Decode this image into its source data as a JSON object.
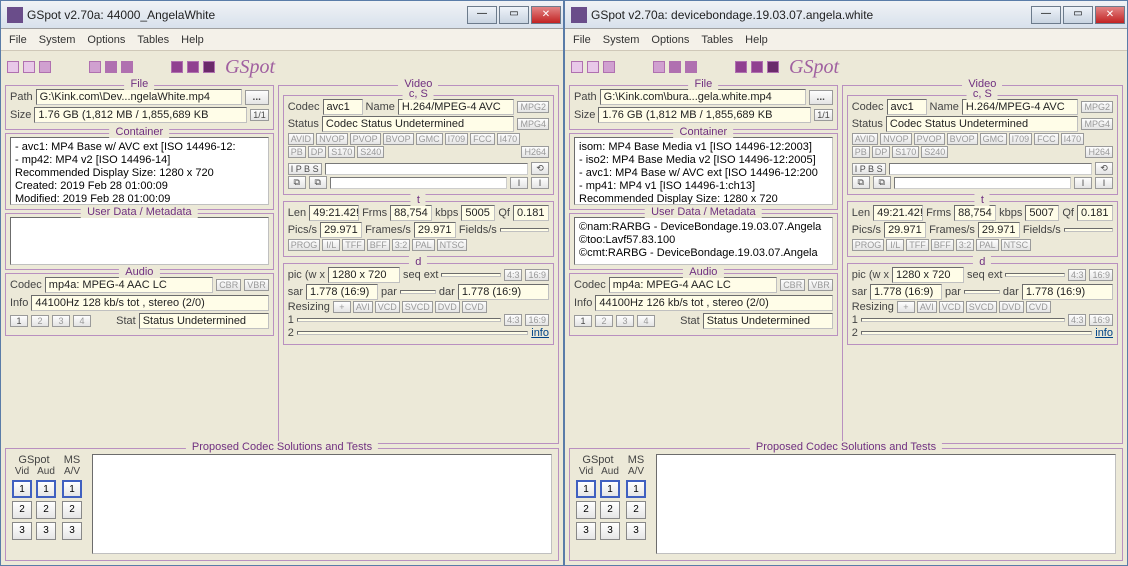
{
  "windows": [
    {
      "title": "GSpot v2.70a: 44000_AngelaWhite",
      "menu": {
        "file": "File",
        "system": "System",
        "options": "Options",
        "tables": "Tables",
        "help": "Help"
      },
      "logo": "GSpot",
      "winbtn": {
        "min": "—",
        "max": "▭",
        "close": "✕"
      },
      "file": {
        "heading": "File",
        "path_label": "Path",
        "path": "G:\\Kink.com\\Dev...ngelaWhite.mp4",
        "browse": "...",
        "size_label": "Size",
        "size": "1.76 GB (1,812 MB / 1,855,689 KB",
        "size_btn": "1/1"
      },
      "container": {
        "heading": "Container",
        "lines": [
          "- avc1: MP4 Base w/ AVC ext [ISO 14496-12:",
          "- mp42: MP4 v2 [ISO 14496-14]",
          "Recommended Display Size: 1280 x 720",
          "Created:   2019 Feb 28   01:00:09",
          "Modified:  2019 Feb 28   01:00:09"
        ]
      },
      "userdata": {
        "heading": "User Data / Metadata",
        "lines": []
      },
      "audio": {
        "heading": "Audio",
        "codec_label": "Codec",
        "codec": "mp4a: MPEG-4 AAC LC",
        "btn_cbr": "CBR",
        "btn_vbr": "VBR",
        "info_label": "Info",
        "info": "44100Hz  128 kb/s tot , stereo (2/0)",
        "stat_label": "Stat",
        "stat": "Status Undetermined",
        "b1": "1",
        "b2": "2",
        "b3": "3",
        "b4": "4"
      },
      "video": {
        "heading": "Video",
        "cs_heading": "c, S",
        "codec_label": "Codec",
        "codec_val": "avc1",
        "name_label": "Name",
        "name_val": "H.264/MPEG-4 AVC",
        "status_label": "Status",
        "status_val": "Codec Status Undetermined",
        "btn_mpg2": "MPG2",
        "btn_mpg4": "MPG4",
        "btn_h264": "H264",
        "btns_row1": [
          "AVID",
          "NVOP",
          "PVOP",
          "BVOP",
          "GMC",
          "I709",
          "FCC",
          "I470"
        ],
        "btns_row2": [
          "PB",
          "DP",
          "S170",
          "S240"
        ],
        "ipbs": "I P B S",
        "t_heading": "t",
        "len_label": "Len",
        "len_val": "49:21.42!",
        "frms_label": "Frms",
        "frms_val": "88,754",
        "kbps_label": "kbps",
        "kbps_val": "5005",
        "qf_label": "Qf",
        "qf_val": "0.181",
        "pics_label": "Pics/s",
        "pics_val": "29.971",
        "frames_label": "Frames/s",
        "frames_val": "29.971",
        "fields_label": "Fields/s",
        "fields_val": "",
        "btns_row3": [
          "PROG",
          "I/L",
          "TFF",
          "BFF",
          "3:2",
          "PAL",
          "NTSC"
        ],
        "d_heading": "d",
        "pic_label": "pic (w x",
        "pic_val": "1280 x 720",
        "seq_label": "seq ext",
        "seq_val": "",
        "d43": "4:3",
        "d169": "16:9",
        "sar_label": "sar",
        "sar_val": "1.778 (16:9)",
        "par_label": "par",
        "par_val": "",
        "dar_label": "dar",
        "dar_val": "1.778 (16:9)",
        "resizing_label": "Resizing",
        "rbtns": [
          "+",
          "AVI",
          "VCD",
          "SVCD",
          "DVD",
          "CVD"
        ],
        "r1_label": "1",
        "r2_label": "2",
        "info_link": "info"
      },
      "proposed": {
        "heading": "Proposed Codec Solutions and Tests",
        "gspot": "GSpot",
        "vid": "Vid",
        "aud": "Aud",
        "ms": "MS",
        "av": "A/V",
        "n1": "1",
        "n2": "2",
        "n3": "3"
      }
    },
    {
      "title": "GSpot v2.70a: devicebondage.19.03.07.angela.white",
      "menu": {
        "file": "File",
        "system": "System",
        "options": "Options",
        "tables": "Tables",
        "help": "Help"
      },
      "logo": "GSpot",
      "winbtn": {
        "min": "—",
        "max": "▭",
        "close": "✕"
      },
      "file": {
        "heading": "File",
        "path_label": "Path",
        "path": "G:\\Kink.com\\bura...gela.white.mp4",
        "browse": "...",
        "size_label": "Size",
        "size": "1.76 GB (1,812 MB / 1,855,689 KB",
        "size_btn": "1/1"
      },
      "container": {
        "heading": "Container",
        "lines": [
          "isom: MP4  Base Media v1 [ISO 14496-12:2003]",
          "- iso2: MP4 Base Media v2 [ISO 14496-12:2005]",
          "- avc1: MP4 Base w/ AVC ext [ISO 14496-12:200",
          "- mp41: MP4 v1 [ISO 14496-1:ch13]",
          "Recommended Display Size: 1280 x 720"
        ]
      },
      "userdata": {
        "heading": "User Data / Metadata",
        "lines": [
          "©nam:RARBG - DeviceBondage.19.03.07.Angela",
          "©too:Lavf57.83.100",
          "©cmt:RARBG - DeviceBondage.19.03.07.Angela"
        ]
      },
      "audio": {
        "heading": "Audio",
        "codec_label": "Codec",
        "codec": "mp4a: MPEG-4 AAC LC",
        "btn_cbr": "CBR",
        "btn_vbr": "VBR",
        "info_label": "Info",
        "info": "44100Hz  126 kb/s tot , stereo (2/0)",
        "stat_label": "Stat",
        "stat": "Status Undetermined",
        "b1": "1",
        "b2": "2",
        "b3": "3",
        "b4": "4"
      },
      "video": {
        "heading": "Video",
        "cs_heading": "c, S",
        "codec_label": "Codec",
        "codec_val": "avc1",
        "name_label": "Name",
        "name_val": "H.264/MPEG-4 AVC",
        "status_label": "Status",
        "status_val": "Codec Status Undetermined",
        "btn_mpg2": "MPG2",
        "btn_mpg4": "MPG4",
        "btn_h264": "H264",
        "btns_row1": [
          "AVID",
          "NVOP",
          "PVOP",
          "BVOP",
          "GMC",
          "I709",
          "FCC",
          "I470"
        ],
        "btns_row2": [
          "PB",
          "DP",
          "S170",
          "S240"
        ],
        "ipbs": "I P B S",
        "t_heading": "t",
        "len_label": "Len",
        "len_val": "49:21.42!",
        "frms_label": "Frms",
        "frms_val": "88,754",
        "kbps_label": "kbps",
        "kbps_val": "5007",
        "qf_label": "Qf",
        "qf_val": "0.181",
        "pics_label": "Pics/s",
        "pics_val": "29.971",
        "frames_label": "Frames/s",
        "frames_val": "29.971",
        "fields_label": "Fields/s",
        "fields_val": "",
        "btns_row3": [
          "PROG",
          "I/L",
          "TFF",
          "BFF",
          "3:2",
          "PAL",
          "NTSC"
        ],
        "d_heading": "d",
        "pic_label": "pic (w x",
        "pic_val": "1280 x 720",
        "seq_label": "seq ext",
        "seq_val": "",
        "d43": "4:3",
        "d169": "16:9",
        "sar_label": "sar",
        "sar_val": "1.778 (16:9)",
        "par_label": "par",
        "par_val": "",
        "dar_label": "dar",
        "dar_val": "1.778 (16:9)",
        "resizing_label": "Resizing",
        "rbtns": [
          "+",
          "AVI",
          "VCD",
          "SVCD",
          "DVD",
          "CVD"
        ],
        "r1_label": "1",
        "r2_label": "2",
        "info_link": "info"
      },
      "proposed": {
        "heading": "Proposed Codec Solutions and Tests",
        "gspot": "GSpot",
        "vid": "Vid",
        "aud": "Aud",
        "ms": "MS",
        "av": "A/V",
        "n1": "1",
        "n2": "2",
        "n3": "3"
      }
    }
  ]
}
